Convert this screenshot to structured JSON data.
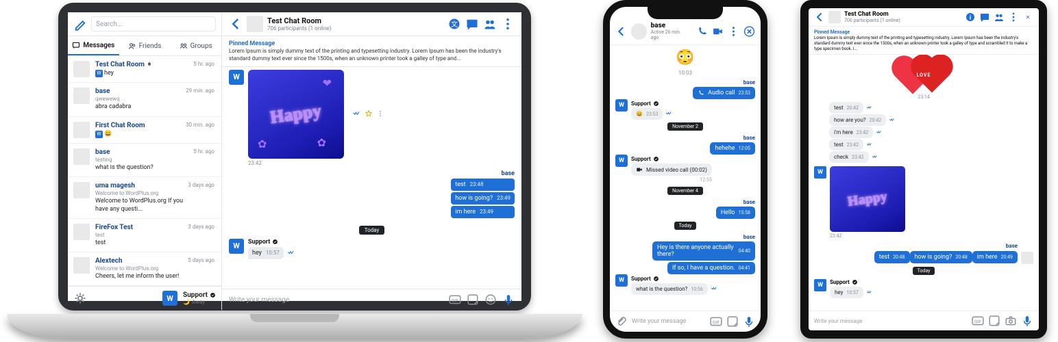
{
  "laptop": {
    "search_placeholder": "Search...",
    "tabs": {
      "messages": "Messages",
      "friends": "Friends",
      "groups": "Groups"
    },
    "chats": [
      {
        "name": "Test Chat Room",
        "sub": "",
        "txt": "hey",
        "time": "5 hr. ago",
        "pinned": true,
        "group": true,
        "badge_w": true
      },
      {
        "name": "base",
        "sub": "qwewewq",
        "txt": "abra cadabra",
        "time": "29 min. ago"
      },
      {
        "name": "First Chat Room",
        "sub": "",
        "txt": "",
        "time": "30 min. ago",
        "group": true,
        "badge_w": true,
        "emoji": "😄"
      },
      {
        "name": "base",
        "sub": "testing",
        "txt": "what is the question?",
        "time": "5 hr. ago"
      },
      {
        "name": "uma magesh",
        "sub": "Welcome to WordPlus.org",
        "txt": "Welcome to WordPlus.org If you have any questi...",
        "time": "3 days ago"
      },
      {
        "name": "FireFox Test",
        "sub": "test",
        "txt": "test",
        "time": "3 days ago"
      },
      {
        "name": "Alextech",
        "sub": "Welcome to WordPlus.org",
        "txt": "Cheers, let me inform the user!",
        "time": "5 days ago"
      }
    ],
    "footer": {
      "avatar": "W",
      "name": "Support",
      "status": "Away",
      "moon": "🌙"
    },
    "header": {
      "title": "Test Chat Room",
      "sub": "706 participants (1 online)"
    },
    "pinned": {
      "title": "Pinned Message",
      "body": "Lorem Ipsum is simply dummy text of the printing and typesetting industry. Lorem Ipsum has been the industry's standard dummy text ever since the 1500s, when an unknown printer took a galley of type and..."
    },
    "msgs": {
      "img_time": "23:42",
      "right_sender": "base",
      "out": [
        {
          "text": "test",
          "time": "23:48"
        },
        {
          "text": "how is going?",
          "time": "23:49"
        },
        {
          "text": "im here",
          "time": "23:49"
        }
      ],
      "today": "Today",
      "in_sender": "Support",
      "in": {
        "text": "hey",
        "time": "10:57"
      }
    },
    "compose_placeholder": "Write your message",
    "avatar_letter": "W",
    "happy_label": "Happy"
  },
  "phone": {
    "header": {
      "title": "base",
      "sub": "Active 26 min. ago"
    },
    "time1": "10:03",
    "out1_sender": "base",
    "audio_call": "Audio call",
    "audio_time": "23:53",
    "support": "Support",
    "emoji_time": "23:53",
    "date1": "November 2",
    "hehehe": "hehehe",
    "hehehe_time": "12:05",
    "missed": "Missed video call (00:02)",
    "missed_time": "12:55",
    "date2": "November 4",
    "hello": "Hello",
    "hello_time": "15:58",
    "today": "Today",
    "q1": "Hey is there anyone actually there?",
    "q1_time": "04:40",
    "q2": "If so, I have a question.",
    "q2_time": "04:41",
    "ans": "what is the question?",
    "ans_time": "10:56",
    "compose_placeholder": "Write your message",
    "avatar_letter": "W",
    "base": "base"
  },
  "tablet": {
    "header": {
      "title": "Test Chat Room",
      "sub": "706 participants (1 online)"
    },
    "pinned": {
      "title": "Pinned Message",
      "body": "Lorem Ipsum is simply dummy text of the printing and typesetting industry. Lorem Ipsum has been the industry's standard dummy text ever since the 1500s, when an unknown printer took a galley of type and scrambled it to make a type specimen book. I..."
    },
    "hearts_label": "LOVE",
    "time1": "23:14",
    "in_rows": [
      {
        "text": "test",
        "time": "20:42"
      },
      {
        "text": "how are you?",
        "time": "20:42"
      },
      {
        "text": "i'm here",
        "time": "23:42"
      },
      {
        "text": "test",
        "time": "23:42"
      },
      {
        "text": "check",
        "time": "23:42"
      }
    ],
    "img_time": "23:42",
    "base": "base",
    "out_rows": [
      {
        "text": "test",
        "time": "20:48"
      },
      {
        "text": "how is going?",
        "time": "20:48"
      },
      {
        "text": "im here",
        "time": "20:49"
      }
    ],
    "today": "Today",
    "support": "Support",
    "hey": "hey",
    "hey_time": "10:57",
    "compose_placeholder": "Write your message",
    "avatar_letter": "W",
    "happy_label": "Happy"
  }
}
